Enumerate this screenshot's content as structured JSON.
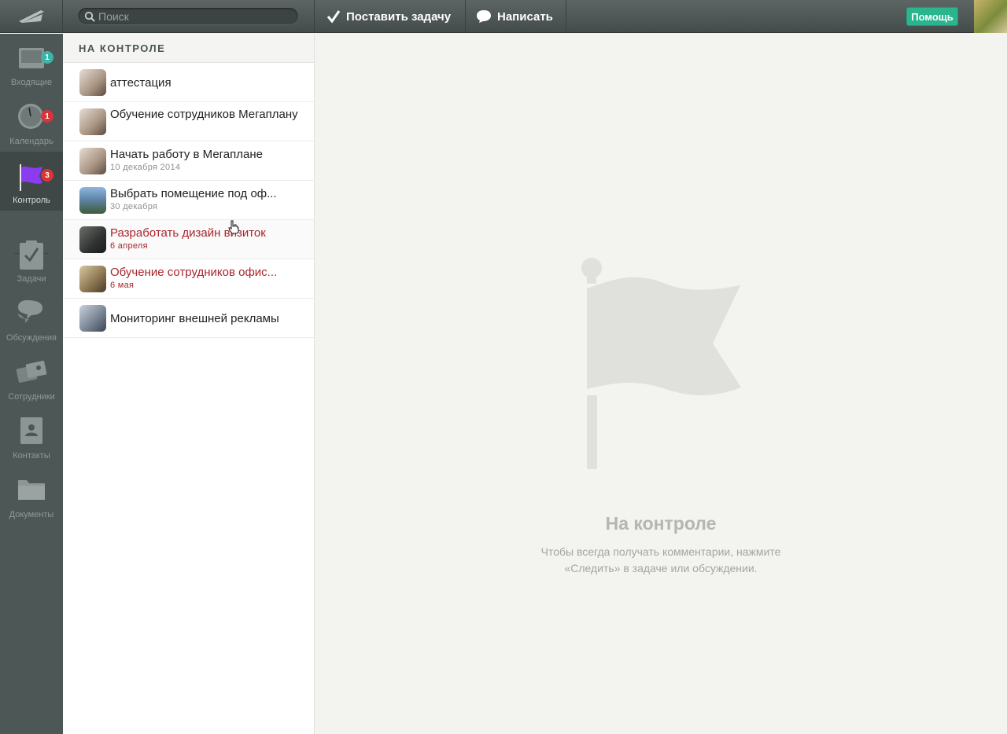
{
  "topbar": {
    "search_placeholder": "Поиск",
    "new_task_label": "Поставить задачу",
    "write_label": "Написать",
    "help_label": "Помощь"
  },
  "nav": {
    "items": [
      {
        "label": "Входящие",
        "icon": "inbox-icon",
        "badge": "1",
        "badge_color": "#3fb3a9"
      },
      {
        "label": "Календарь",
        "icon": "clock-icon",
        "badge": "1",
        "badge_color": "#d9343b"
      },
      {
        "label": "Контроль",
        "icon": "flag-icon",
        "badge": "3",
        "badge_color": "#d9343b",
        "active": true
      },
      {
        "label": "Задачи",
        "icon": "clipboard-icon"
      },
      {
        "label": "Обсуждения",
        "icon": "chat-bubbles-icon"
      },
      {
        "label": "Сотрудники",
        "icon": "id-cards-icon"
      },
      {
        "label": "Контакты",
        "icon": "address-book-icon"
      },
      {
        "label": "Документы",
        "icon": "folder-icon"
      }
    ]
  },
  "list": {
    "header": "НА КОНТРОЛЕ",
    "rows": [
      {
        "title": "аттестация",
        "date": "",
        "overdue": false
      },
      {
        "title": "Обучение сотрудников Мегаплану",
        "date": "",
        "overdue": false
      },
      {
        "title": "Начать работу в Мегаплане",
        "date": "10 декабря 2014",
        "overdue": false
      },
      {
        "title": "Выбрать помещение под оф...",
        "date": "30 декабря",
        "overdue": false
      },
      {
        "title": "Разработать дизайн визиток",
        "date": "6 апреля",
        "overdue": true
      },
      {
        "title": "Обучение сотрудников офис...",
        "date": "6 мая",
        "overdue": true
      },
      {
        "title": "Мониторинг внешней рекламы",
        "date": "",
        "overdue": false
      }
    ]
  },
  "empty_state": {
    "title": "На контроле",
    "line1": "Чтобы всегда получать комментарии, нажмите",
    "line2": "«Следить» в задаче или обсуждении."
  },
  "colors": {
    "accent_help": "#2bb58f",
    "overdue_text": "#a8262b",
    "active_flag": "#8a3cf0"
  }
}
